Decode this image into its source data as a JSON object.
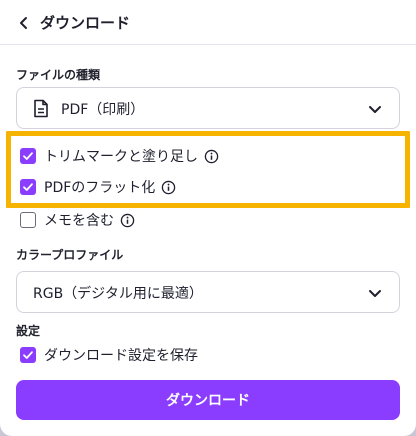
{
  "header": {
    "title": "ダウンロード",
    "back_icon": "chevron-left-icon"
  },
  "file_type": {
    "label": "ファイルの種類",
    "value": "PDF（印刷）",
    "icon": "document-icon"
  },
  "options": [
    {
      "label": "トリムマークと塗り足し",
      "checked": true,
      "info": true
    },
    {
      "label": "PDFのフラット化",
      "checked": true,
      "info": true
    },
    {
      "label": "メモを含む",
      "checked": false,
      "info": true
    }
  ],
  "color_profile": {
    "label": "カラープロファイル",
    "value": "RGB（デジタル用に最適）"
  },
  "settings": {
    "label": "設定",
    "save_settings": {
      "label": "ダウンロード設定を保存",
      "checked": true
    }
  },
  "download_button": {
    "label": "ダウンロード"
  },
  "colors": {
    "accent": "#8b3dff",
    "highlight": "#f6b400"
  }
}
